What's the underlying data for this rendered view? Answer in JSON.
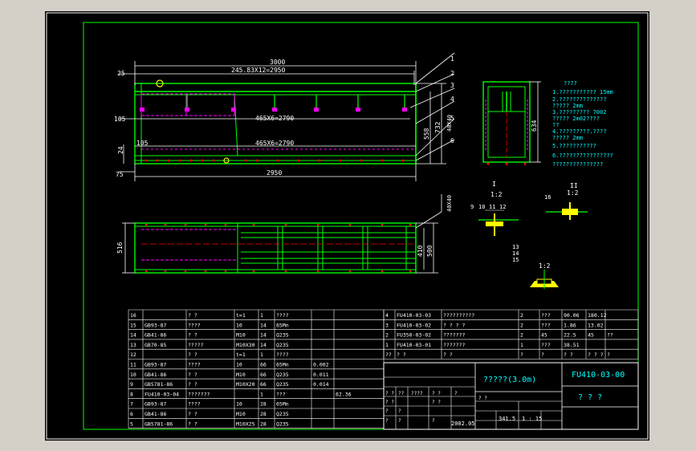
{
  "dims": {
    "top_overall": "3000",
    "top_pitch": "245.83X12=2950",
    "left_25": "25",
    "left_105": "105",
    "left_24": "24",
    "left_75": "75",
    "mid_105": "105",
    "upper_chain": "465X6=2790",
    "lower_chain": "465X6=2790",
    "bottom_len": "2950",
    "right_558": "558",
    "right_732": "732",
    "right_tag": "40X40",
    "side_height": "634",
    "plan_width": "516",
    "plan_410": "410",
    "plan_500": "500",
    "plan_tag": "40X40"
  },
  "callouts": [
    "1",
    "2",
    "3",
    "4",
    "5",
    "6"
  ],
  "details": {
    "section1_label": "I",
    "section1_scale": "1:2",
    "section1_parts": [
      "9",
      "10",
      "11",
      "12"
    ],
    "section2_label": "II",
    "section2_scale": "1:2",
    "section2_part": "16",
    "section3_parts": [
      "13",
      "14",
      "15"
    ],
    "section3_scale": "1:2"
  },
  "notes": {
    "heading": "????",
    "lines": [
      "1.???????????   15mm",
      "2.??????????????",
      "  ?????  2mm",
      "3.?????????   7002",
      "  ?????   2m02????",
      "  ??",
      "4.?????????.????",
      "  ?????  2mm",
      "5.???????????",
      "6.????????????????",
      "  ???????????????"
    ]
  },
  "bom_left": [
    {
      "no": "16",
      "code": "",
      "name": "?   ?",
      "spec": "t=1",
      "qty": "1",
      "mat": "????",
      "w1": "",
      "w2": ""
    },
    {
      "no": "15",
      "code": "GB93-87",
      "name": "????",
      "spec": "10",
      "qty": "14",
      "mat": "65Mn",
      "w1": "",
      "w2": ""
    },
    {
      "no": "14",
      "code": "GB41-86",
      "name": "?   ?",
      "spec": "M10",
      "qty": "14",
      "mat": "Q235",
      "w1": "",
      "w2": ""
    },
    {
      "no": "13",
      "code": "GB70-85",
      "name": "?????",
      "spec": "M10X30",
      "qty": "14",
      "mat": "Q235",
      "w1": "",
      "w2": ""
    },
    {
      "no": "12",
      "code": "",
      "name": "?   ?",
      "spec": "t=1",
      "qty": "1",
      "mat": "????",
      "w1": "",
      "w2": ""
    },
    {
      "no": "11",
      "code": "GB93-87",
      "name": "????",
      "spec": "10",
      "qty": "66",
      "mat": "65Mn",
      "w1": "0.002",
      "w2": ""
    },
    {
      "no": "10",
      "code": "GB41-86",
      "name": "?   ?",
      "spec": "M10",
      "qty": "66",
      "mat": "Q235",
      "w1": "0.011",
      "w2": ""
    },
    {
      "no": "9",
      "code": "GB5781-86",
      "name": "?   ?",
      "spec": "M10X20",
      "qty": "66",
      "mat": "Q235",
      "w1": "0.014",
      "w2": ""
    },
    {
      "no": "8",
      "code": "FU410-03-04",
      "name": "???????",
      "spec": "",
      "qty": "1",
      "mat": "???",
      "w1": "",
      "w2": "62.36"
    },
    {
      "no": "7",
      "code": "GB93-87",
      "name": "????",
      "spec": "10",
      "qty": "28",
      "mat": "65Mn",
      "w1": "",
      "w2": ""
    },
    {
      "no": "6",
      "code": "GB41-86",
      "name": "?   ?",
      "spec": "M10",
      "qty": "28",
      "mat": "Q235",
      "w1": "",
      "w2": ""
    },
    {
      "no": "5",
      "code": "GB5781-86",
      "name": "?   ?",
      "spec": "M10X25",
      "qty": "28",
      "mat": "Q235",
      "w1": "",
      "w2": ""
    }
  ],
  "bom_right": [
    {
      "no": "4",
      "code": "FU410-03-03",
      "name": "??????????",
      "qty": "2",
      "mat": "???",
      "w1": "90.06",
      "w2": "180.12",
      "note": ""
    },
    {
      "no": "3",
      "code": "FU410-03-02",
      "name": "? ? ? ?",
      "qty": "2",
      "mat": "???",
      "w1": "1.86",
      "w2": "13.02",
      "note": ""
    },
    {
      "no": "2",
      "code": "FU350-03-02",
      "name": "???????",
      "qty": "2",
      "mat": "45",
      "w1": "22.5",
      "w2": "45",
      "note": "??"
    },
    {
      "no": "1",
      "code": "FU410-03-01",
      "name": "???????",
      "qty": "1",
      "mat": "???",
      "w1": "38.51",
      "w2": "",
      "note": ""
    }
  ],
  "bom_header": [
    "??",
    "?   ?",
    "?   ?",
    "?",
    "?",
    "?   ?",
    "? ? ?",
    "?"
  ],
  "title_block": {
    "product_name": "?????(3.0m)",
    "drawing_no": "FU410-03-00",
    "company": "?  ?  ?",
    "weight": "341.5",
    "scale": "1 : 15",
    "date": "2002.05",
    "row1": [
      "? ?",
      "??",
      "????",
      "? ?",
      "?"
    ],
    "row2": [
      "? ?",
      "? ?",
      "? ?"
    ],
    "row3": [
      "?",
      "?"
    ],
    "row4": [
      "?",
      "?",
      "?"
    ]
  }
}
